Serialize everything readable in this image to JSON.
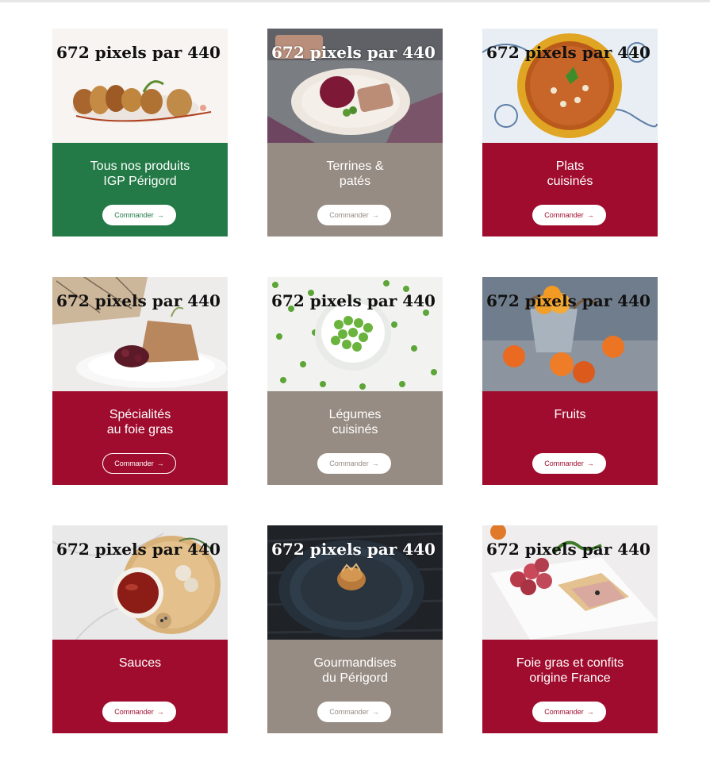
{
  "placeholder_text": "672 pixels par 440",
  "colors": {
    "green": "#237a46",
    "taupe": "#978c83",
    "red": "#a00c2e"
  },
  "cards": [
    {
      "title": "Tous nos produits\nIGP Périgord",
      "button": "Commander",
      "arrow": "→",
      "panel": "green",
      "image": "foie-gras-plated"
    },
    {
      "title": "Terrines &\npatés",
      "button": "Commander",
      "arrow": "→",
      "panel": "taupe",
      "image": "terrine-plate"
    },
    {
      "title": "Plats\ncuisinés",
      "button": "Commander",
      "arrow": "→",
      "panel": "red",
      "image": "soup-bowl"
    },
    {
      "title": "Spécialités\nau foie gras",
      "button": "Commander",
      "arrow": "→",
      "panel": "red",
      "image": "foie-gras-toast"
    },
    {
      "title": "Légumes\ncuisinés",
      "button": "Commander",
      "arrow": "→",
      "panel": "taupe",
      "image": "green-peas"
    },
    {
      "title": "Fruits",
      "button": "Commander",
      "arrow": "→",
      "panel": "red",
      "image": "apricots"
    },
    {
      "title": "Sauces",
      "button": "Commander",
      "arrow": "→",
      "panel": "red",
      "image": "sauce-board"
    },
    {
      "title": "Gourmandises\ndu Périgord",
      "button": "Commander",
      "arrow": "→",
      "panel": "taupe",
      "image": "dark-plate"
    },
    {
      "title": "Foie gras et confits\norigine France",
      "button": "Commander",
      "arrow": "→",
      "panel": "red",
      "image": "foie-gras-grapes"
    }
  ]
}
